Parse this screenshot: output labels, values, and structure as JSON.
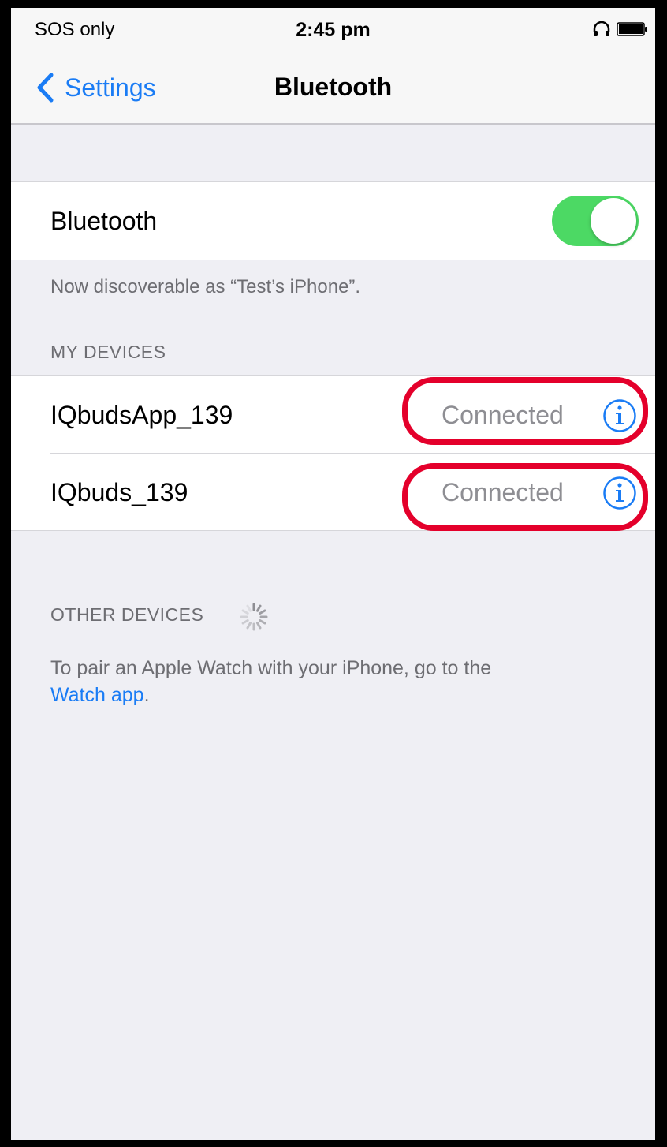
{
  "status_bar": {
    "carrier": "SOS only",
    "time": "2:45 pm",
    "icons": [
      "headphone-icon",
      "battery-icon"
    ]
  },
  "nav": {
    "back_label": "Settings",
    "title": "Bluetooth"
  },
  "bluetooth": {
    "label": "Bluetooth",
    "enabled": true,
    "discoverable_text": "Now discoverable as “Test’s iPhone”."
  },
  "my_devices": {
    "header": "MY DEVICES",
    "items": [
      {
        "name": "IQbudsApp_139",
        "status": "Connected"
      },
      {
        "name": "IQbuds_139",
        "status": "Connected"
      }
    ]
  },
  "other_devices": {
    "header": "OTHER DEVICES",
    "pair_text": "To pair an Apple Watch with your iPhone, go to the",
    "watch_link": "Watch app",
    "pair_suffix": "."
  },
  "colors": {
    "accent": "#1a7cf5",
    "toggle_on": "#4cd964",
    "highlight": "#e4002b",
    "background": "#efeff4"
  }
}
